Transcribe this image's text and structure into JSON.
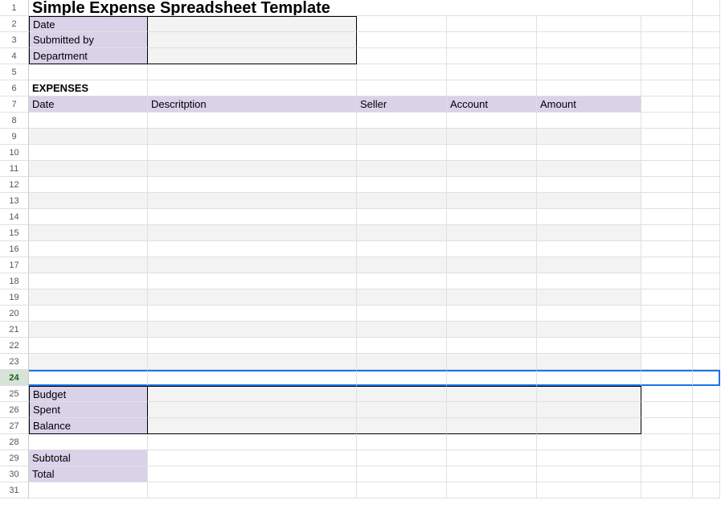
{
  "rows": [
    "1",
    "2",
    "3",
    "4",
    "5",
    "6",
    "7",
    "8",
    "9",
    "10",
    "11",
    "12",
    "13",
    "14",
    "15",
    "16",
    "17",
    "18",
    "19",
    "20",
    "21",
    "22",
    "23",
    "24",
    "25",
    "26",
    "27",
    "28",
    "29",
    "30",
    "31"
  ],
  "title": "Simple Expense Spreadsheet Template",
  "labels": {
    "date": "Date",
    "submitted_by": "Submitted by",
    "department": "Department",
    "expenses": "EXPENSES",
    "budget": "Budget",
    "spent": "Spent",
    "balance": "Balance",
    "subtotal": "Subtotal",
    "total": "Total"
  },
  "columns": {
    "date": "Date",
    "description": "Descritption",
    "seller": "Seller",
    "account": "Account",
    "amount": "Amount"
  },
  "values": {
    "date": "",
    "submitted_by": "",
    "department": "",
    "budget": "",
    "spent": "",
    "balance": "",
    "subtotal": "",
    "total": ""
  }
}
